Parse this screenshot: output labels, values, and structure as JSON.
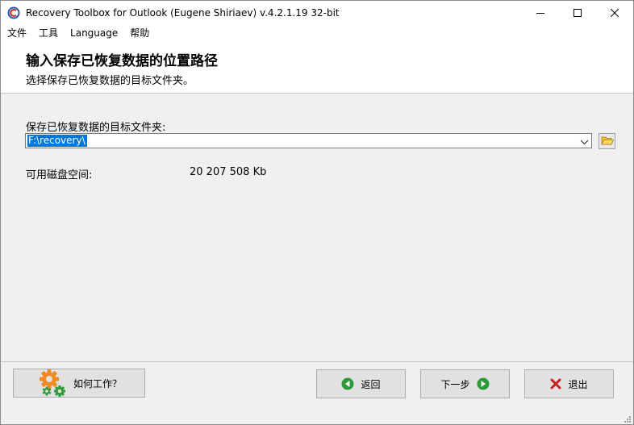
{
  "window": {
    "title": "Recovery Toolbox for Outlook (Eugene Shiriaev) v.4.2.1.19 32-bit"
  },
  "menu": {
    "items": [
      "文件",
      "工具",
      "Language",
      "帮助"
    ]
  },
  "header": {
    "title": "输入保存已恢复数据的位置路径",
    "subtitle": "选择保存已恢复数据的目标文件夹。"
  },
  "content": {
    "folder_label": "保存已恢复数据的目标文件夹:",
    "folder_path": "F:\\recovery\\",
    "space_label": "可用磁盘空间:",
    "space_value": "20 207 508 Kb"
  },
  "buttons": {
    "help": "如何工作？",
    "back": "返回",
    "next": "下一步",
    "exit": "退出"
  },
  "icons": {
    "app": "app-logo-icon",
    "browse": "folder-open-icon",
    "help": "gears-icon",
    "back": "arrow-left-icon",
    "next": "arrow-right-icon",
    "exit": "x-icon"
  },
  "colors": {
    "selection": "#0078d7",
    "nav_arrow": "#2e9a3a",
    "exit_x": "#c81e1e",
    "gear_orange": "#f08a1e",
    "gear_green": "#2e9a3a"
  }
}
